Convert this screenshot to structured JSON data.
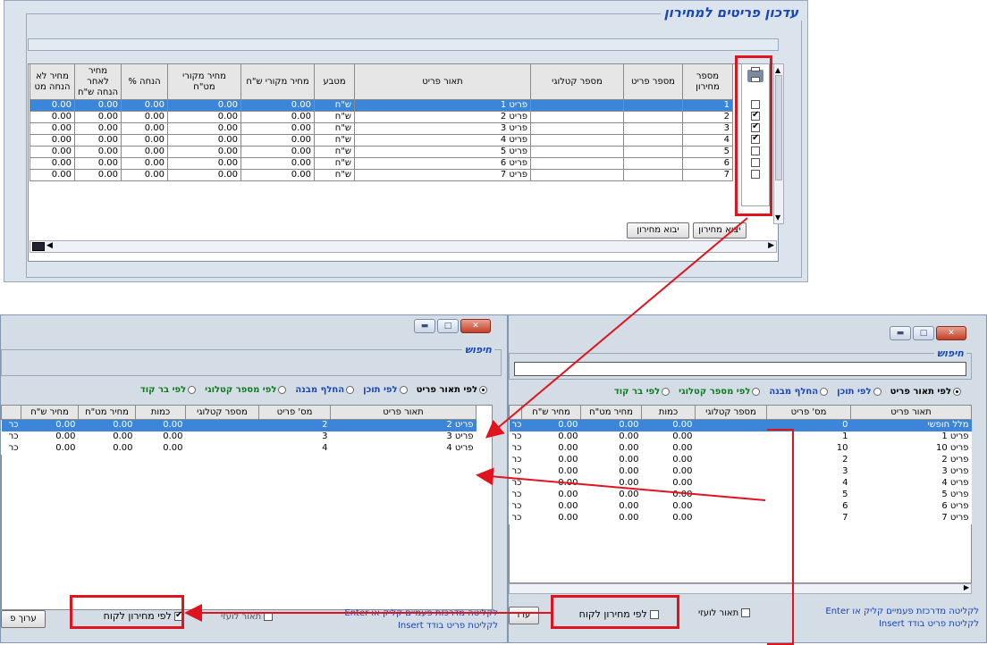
{
  "top": {
    "title": "עדכון פריטים למחירון",
    "columns": [
      "מספר מחירון",
      "מספר פריט",
      "מספר קטלוגי",
      "תאור פריט",
      "מטבע",
      "מחיר מקורי ש\"ח",
      "מחיר מקורי מט\"ח",
      "% הנחה",
      "מחיר לאחר הנחה ש\"ח",
      "מחיר לא הנחה מט"
    ],
    "rows": [
      {
        "num": "1",
        "desc": "פריט 1",
        "cur": "ש\"ח",
        "p1": "0.00",
        "p2": "0.00",
        "d": "0.00",
        "p3": "0.00",
        "p4": "0.00",
        "checked": false
      },
      {
        "num": "2",
        "desc": "פריט 2",
        "cur": "ש\"ח",
        "p1": "0.00",
        "p2": "0.00",
        "d": "0.00",
        "p3": "0.00",
        "p4": "0.00",
        "checked": true
      },
      {
        "num": "3",
        "desc": "פריט 3",
        "cur": "ש\"ח",
        "p1": "0.00",
        "p2": "0.00",
        "d": "0.00",
        "p3": "0.00",
        "p4": "0.00",
        "checked": true
      },
      {
        "num": "4",
        "desc": "פריט 4",
        "cur": "ש\"ח",
        "p1": "0.00",
        "p2": "0.00",
        "d": "0.00",
        "p3": "0.00",
        "p4": "0.00",
        "checked": true
      },
      {
        "num": "5",
        "desc": "פריט 5",
        "cur": "ש\"ח",
        "p1": "0.00",
        "p2": "0.00",
        "d": "0.00",
        "p3": "0.00",
        "p4": "0.00",
        "checked": false
      },
      {
        "num": "6",
        "desc": "פריט 6",
        "cur": "ש\"ח",
        "p1": "0.00",
        "p2": "0.00",
        "d": "0.00",
        "p3": "0.00",
        "p4": "0.00",
        "checked": false
      },
      {
        "num": "7",
        "desc": "פריט 7",
        "cur": "ש\"ח",
        "p1": "0.00",
        "p2": "0.00",
        "d": "0.00",
        "p3": "0.00",
        "p4": "0.00",
        "checked": false
      }
    ],
    "export_label": "יצוא מחירון",
    "import_label": "יבוא מחירון"
  },
  "search_left": {
    "group_label": "חיפוש",
    "radios": [
      {
        "label": "לפי תאור פריט",
        "on": true,
        "color": "#000000"
      },
      {
        "label": "לפי תוכן",
        "on": false,
        "color": "#1846b8"
      },
      {
        "label": "החלף מבנה",
        "on": false,
        "color": "#1846b8"
      },
      {
        "label": "לפי מספר קטלוגי",
        "on": false,
        "color": "#0d7a1c"
      },
      {
        "label": "לפי בר קוד",
        "on": false,
        "color": "#0d7a1c"
      }
    ],
    "columns": [
      "תאור פריט",
      "מס' פריט",
      "מספר קטלוגי",
      "כמות",
      "מחיר מט\"ח",
      "מחיר ש\"ח"
    ],
    "rows": [
      {
        "desc": "פריט 2",
        "num": "2",
        "qty": "0.00",
        "fx": "0.00",
        "ils": "0.00",
        "x": "כר"
      },
      {
        "desc": "פריט 3",
        "num": "3",
        "qty": "0.00",
        "fx": "0.00",
        "ils": "0.00",
        "x": "כר"
      },
      {
        "desc": "פריט 4",
        "num": "4",
        "qty": "0.00",
        "fx": "0.00",
        "ils": "0.00",
        "x": "כר"
      }
    ],
    "pricelist_label": "לפי מחירון לקוח",
    "pricelist_checked": true,
    "aux_label": "תאור לועזי",
    "hint1": "לקליטה מדרכזת פעמיים קליק או Enter",
    "hint2": "לקליטת פריט בודד Insert",
    "edit_label": "ערוך פ"
  },
  "search_right": {
    "group_label": "חיפוש",
    "radios": [
      {
        "label": "לפי תאור פריט",
        "on": true,
        "color": "#000000"
      },
      {
        "label": "לפי תוכן",
        "on": false,
        "color": "#1846b8"
      },
      {
        "label": "החלף מבנה",
        "on": false,
        "color": "#1846b8"
      },
      {
        "label": "לפי מספר קטלוגי",
        "on": false,
        "color": "#0d7a1c"
      },
      {
        "label": "לפי בר קוד",
        "on": false,
        "color": "#0d7a1c"
      }
    ],
    "columns": [
      "תאור פריט",
      "מס' פריט",
      "מספר קטלוגי",
      "כמות",
      "מחיר מט\"ח",
      "מחיר ש\"ח"
    ],
    "rows": [
      {
        "desc": "מלל חופשי",
        "num": "0",
        "qty": "0.00",
        "fx": "0.00",
        "ils": "0.00",
        "x": "כר"
      },
      {
        "desc": "פריט 1",
        "num": "1",
        "qty": "0.00",
        "fx": "0.00",
        "ils": "0.00",
        "x": "כר"
      },
      {
        "desc": "פריט 10",
        "num": "10",
        "qty": "0.00",
        "fx": "0.00",
        "ils": "0.00",
        "x": "כר"
      },
      {
        "desc": "פריט 2",
        "num": "2",
        "qty": "0.00",
        "fx": "0.00",
        "ils": "0.00",
        "x": "כר"
      },
      {
        "desc": "פריט 3",
        "num": "3",
        "qty": "0.00",
        "fx": "0.00",
        "ils": "0.00",
        "x": "כר"
      },
      {
        "desc": "פריט 4",
        "num": "4",
        "qty": "0.00",
        "fx": "0.00",
        "ils": "0.00",
        "x": "כר"
      },
      {
        "desc": "פריט 5",
        "num": "5",
        "qty": "0.00",
        "fx": "0.00",
        "ils": "0.00",
        "x": "כר"
      },
      {
        "desc": "פריט 6",
        "num": "6",
        "qty": "0.00",
        "fx": "0.00",
        "ils": "0.00",
        "x": "כר"
      },
      {
        "desc": "פריט 7",
        "num": "7",
        "qty": "0.00",
        "fx": "0.00",
        "ils": "0.00",
        "x": "כר"
      }
    ],
    "pricelist_label": "לפי מחירון לקוח",
    "pricelist_checked": false,
    "aux_label": "תאור לועזי",
    "hint1": "לקליטה מדרכזת פעמיים קליק או Enter",
    "hint2": "לקליטת פריט בודד Insert",
    "edit_label": "ערו"
  },
  "colors": {
    "selection": "#3b86d8",
    "annotation": "#e0141e",
    "title": "#1846b8"
  }
}
